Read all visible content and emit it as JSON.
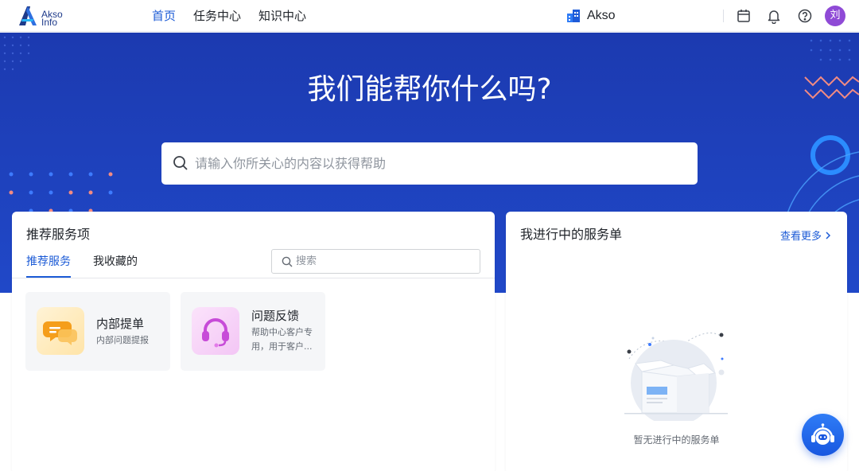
{
  "header": {
    "logo_text_1": "Akso",
    "logo_text_2": "Info",
    "nav": [
      {
        "label": "首页",
        "active": true
      },
      {
        "label": "任务中心",
        "active": false
      },
      {
        "label": "知识中心",
        "active": false
      }
    ],
    "brand_name": "Akso",
    "icons": [
      "calendar-icon",
      "bell-icon",
      "help-icon"
    ],
    "avatar_text": "刘",
    "avatar_color": "#8f4ad6"
  },
  "hero": {
    "title": "我们能帮你什么吗?",
    "search_placeholder": "请输入你所关心的内容以获得帮助",
    "bg_color": "#1c3ab0"
  },
  "recommend": {
    "title": "推荐服务项",
    "tabs": [
      {
        "label": "推荐服务",
        "active": true
      },
      {
        "label": "我收藏的",
        "active": false
      }
    ],
    "search_placeholder": "搜索",
    "services": [
      {
        "title": "内部提单",
        "desc": "内部问题提报",
        "icon": "chat-bubble-icon"
      },
      {
        "title": "问题反馈",
        "desc": "帮助中心客户专用，用于客户...",
        "icon": "headset-icon"
      }
    ]
  },
  "my_tickets": {
    "title": "我进行中的服务单",
    "more_label": "查看更多",
    "empty_text": "暂无进行中的服务单"
  },
  "accent_color": "#1c5bd6"
}
